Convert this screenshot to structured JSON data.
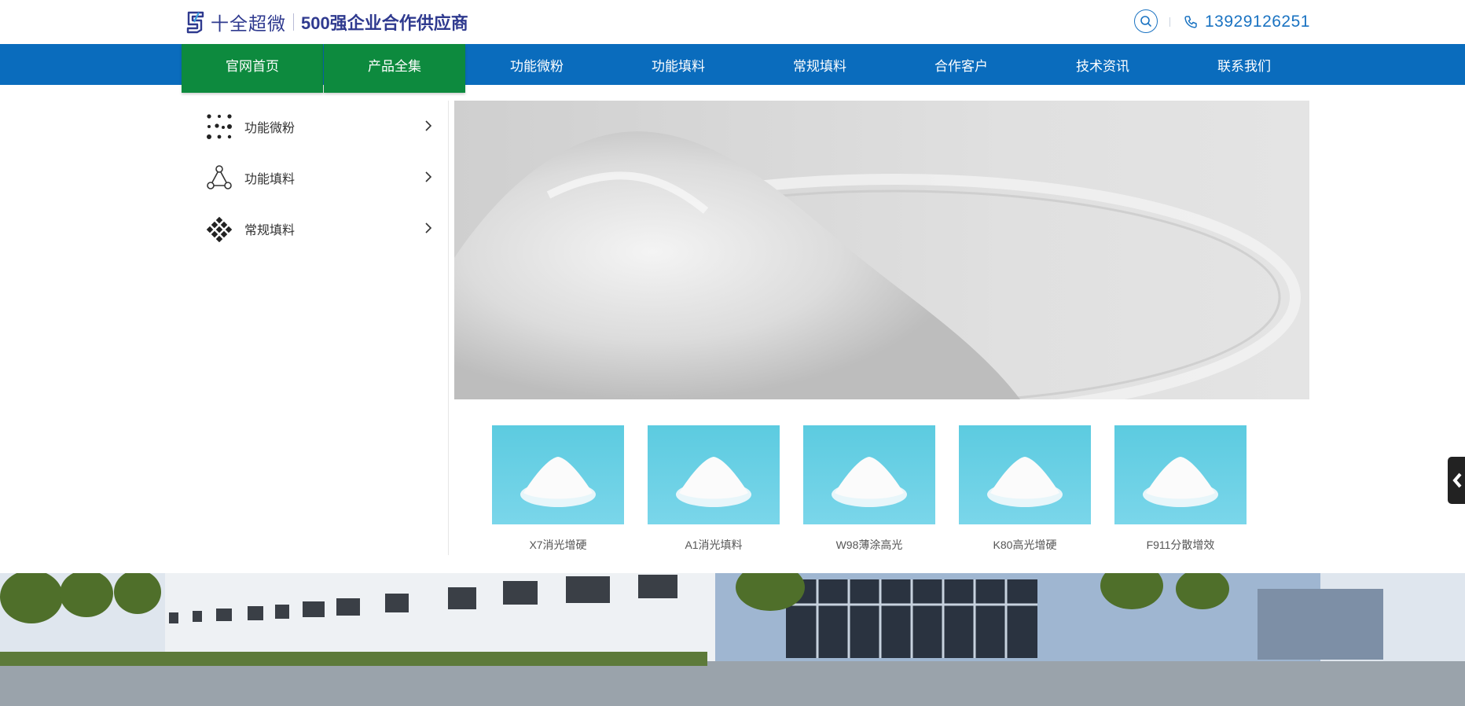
{
  "header": {
    "logo_name": "十全超微",
    "logo_slogan": "500强企业合作供应商",
    "phone": "13929126251"
  },
  "nav": [
    {
      "label": "官网首页",
      "active": true
    },
    {
      "label": "产品全集",
      "active": true
    },
    {
      "label": "功能微粉",
      "active": false
    },
    {
      "label": "功能填料",
      "active": false
    },
    {
      "label": "常规填料",
      "active": false
    },
    {
      "label": "合作客户",
      "active": false
    },
    {
      "label": "技术资讯",
      "active": false
    },
    {
      "label": "联系我们",
      "active": false
    }
  ],
  "sidebar": {
    "items": [
      {
        "label": "功能微粉",
        "icon": "dots-grid-icon"
      },
      {
        "label": "功能填料",
        "icon": "molecule-icon"
      },
      {
        "label": "常规填料",
        "icon": "diamond-grid-icon"
      }
    ]
  },
  "products": [
    {
      "name": "X7消光增硬"
    },
    {
      "name": "A1消光填料"
    },
    {
      "name": "W98薄涂高光"
    },
    {
      "name": "K80高光增硬"
    },
    {
      "name": "F911分散增效"
    }
  ],
  "colors": {
    "brand_blue": "#0a6cbd",
    "active_green": "#0d8a3e",
    "logo_navy": "#2f3a8f",
    "product_bg": "#5ccbe0"
  }
}
